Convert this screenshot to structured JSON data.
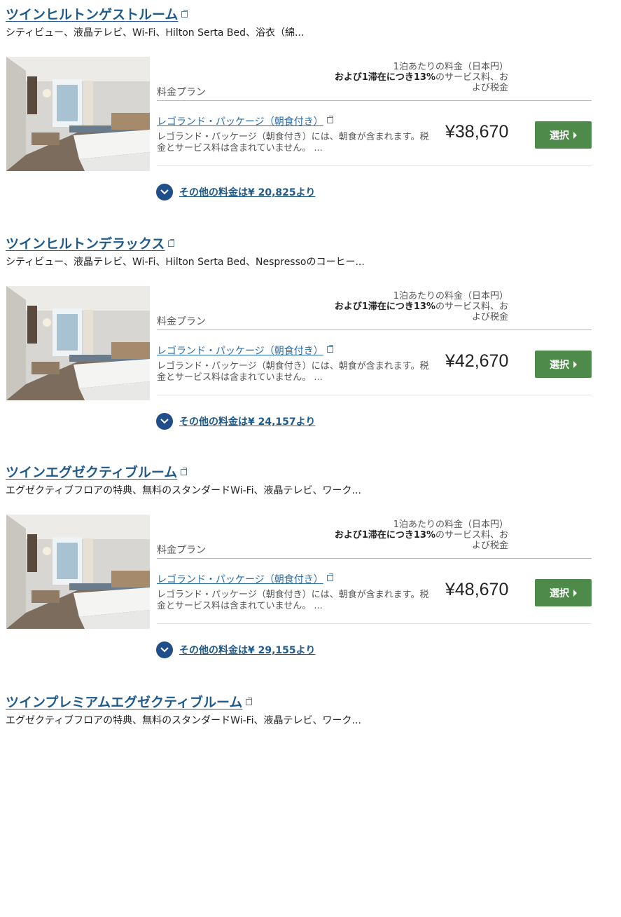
{
  "common": {
    "plan_header": "料金プラン",
    "price_note_line1": "1泊あたりの料金（日本円）",
    "price_note_bold": "および1滞在につき13%",
    "price_note_rest": "のサービス料、お",
    "price_note_line3": "よび税金",
    "select_label": "選択"
  },
  "rooms": [
    {
      "title": "ツインヒルトンゲストルーム",
      "amenities": "シティビュー、液晶テレビ、Wi-Fi、Hilton Serta Bed、浴衣（綿...",
      "plan_name": "レゴランド・パッケージ（朝食付き）",
      "plan_desc": "レゴランド・パッケージ（朝食付き）には、朝食が含まれます。税金とサービス料は含まれていません。 ...",
      "price": "¥38,670",
      "more_rates": "その他の料金は¥ 20,825より"
    },
    {
      "title": "ツインヒルトンデラックス",
      "amenities": "シティビュー、液晶テレビ、Wi-Fi、Hilton Serta Bed、Nespressoのコーヒー...",
      "plan_name": "レゴランド・パッケージ（朝食付き）",
      "plan_desc": "レゴランド・パッケージ（朝食付き）には、朝食が含まれます。税金とサービス料は含まれていません。 ...",
      "price": "¥42,670",
      "more_rates": "その他の料金は¥ 24,157より"
    },
    {
      "title": "ツインエグゼクティブルーム",
      "amenities": "エグゼクティブフロアの特典、無料のスタンダードWi-Fi、液晶テレビ、ワーク...",
      "plan_name": "レゴランド・パッケージ（朝食付き）",
      "plan_desc": "レゴランド・パッケージ（朝食付き）には、朝食が含まれます。税金とサービス料は含まれていません。 ...",
      "price": "¥48,670",
      "more_rates": "その他の料金は¥ 29,155より"
    },
    {
      "title": "ツインプレミアムエグゼクティブルーム",
      "amenities": "エグゼクティブフロアの特典、無料のスタンダードWi-Fi、液晶テレビ、ワーク..."
    }
  ]
}
